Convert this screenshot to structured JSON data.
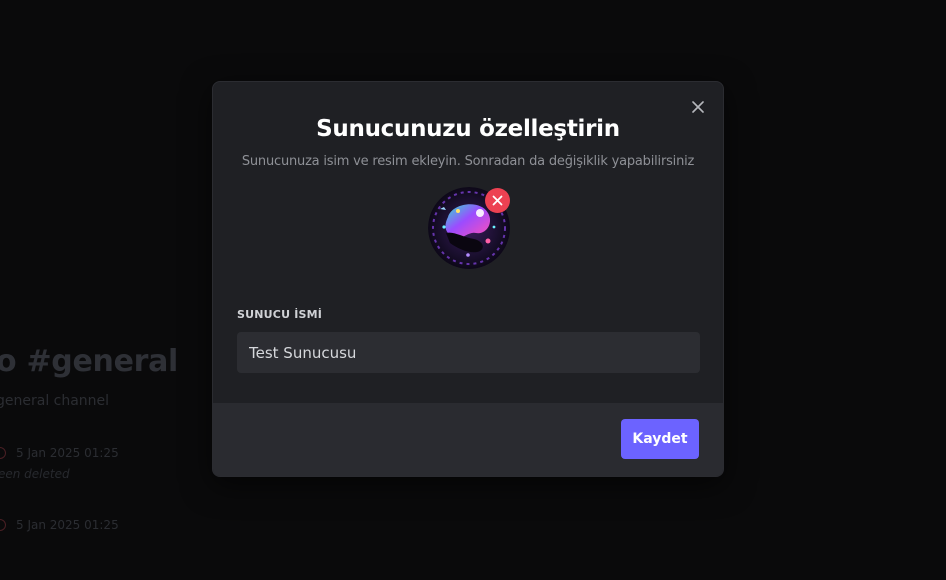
{
  "background": {
    "channel_title": "o #general",
    "channel_subtitle": "general channel",
    "messages": [
      {
        "timestamp": "5 Jan 2025 01:25",
        "note": "een deleted"
      },
      {
        "timestamp": "5 Jan 2025 01:25"
      }
    ]
  },
  "modal": {
    "title": "Sunucunuzu özelleştirin",
    "subtitle": "Sunucunuza isim ve resim ekleyin. Sonradan da değişiklik yapabilirsiniz",
    "close_icon": "close-icon",
    "avatar_icon": "server-avatar-image",
    "remove_icon": "remove-x-icon",
    "server_name_label": "SUNUCU İSMİ",
    "server_name_value": "Test Sunucusu",
    "save_label": "Kaydet"
  },
  "colors": {
    "accent": "#6c63ff",
    "danger": "#ed4152",
    "modal_bg": "#1f2024",
    "footer_bg": "#2a2b30",
    "input_bg": "#2c2d32"
  }
}
